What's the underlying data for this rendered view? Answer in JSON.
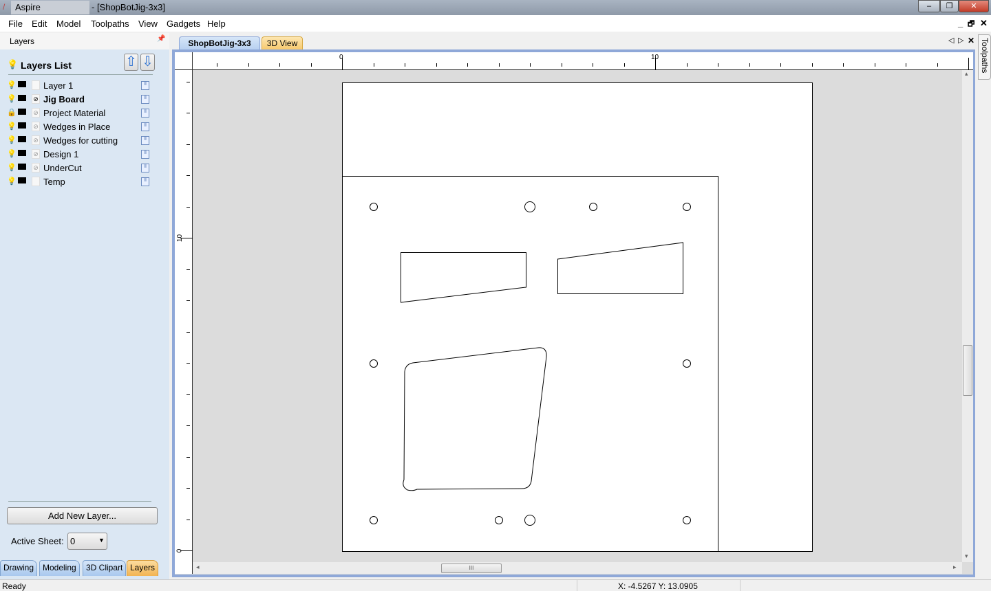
{
  "window": {
    "app_name": "Aspire",
    "document_title": "- [ShopBotJig-3x3]",
    "minimize": "–",
    "restore": "❐",
    "close": "✕"
  },
  "menu": [
    "File",
    "Edit",
    "Model",
    "Toolpaths",
    "View",
    "Gadgets",
    "Help"
  ],
  "mdi_controls": {
    "minimize": "_",
    "restore": "🗗",
    "close": "✕"
  },
  "layers_panel": {
    "title": "Layers",
    "pin": "📌",
    "list_title": "Layers List",
    "move_up": "⇧",
    "move_down": "⇩",
    "layers": [
      {
        "name": "Layer 1",
        "visible": false,
        "bold": false,
        "has_vectors": false
      },
      {
        "name": "Jig Board",
        "visible": true,
        "bold": true,
        "has_vectors": true
      },
      {
        "name": "Project Material",
        "visible": false,
        "locked": true,
        "bold": false,
        "has_vectors": true
      },
      {
        "name": "Wedges in Place",
        "visible": false,
        "bold": false,
        "has_vectors": true
      },
      {
        "name": "Wedges for cutting",
        "visible": true,
        "bold": false,
        "has_vectors": true
      },
      {
        "name": "Design 1",
        "visible": false,
        "bold": false,
        "has_vectors": true
      },
      {
        "name": "UnderCut",
        "visible": false,
        "bold": false,
        "has_vectors": true
      },
      {
        "name": "Temp",
        "visible": true,
        "bold": false,
        "has_vectors": false
      }
    ],
    "add_layer": "Add New Layer...",
    "active_sheet_label": "Active Sheet:",
    "active_sheet_value": "0"
  },
  "bottom_tabs": [
    "Drawing",
    "Modeling",
    "3D Clipart",
    "Layers"
  ],
  "active_bottom_tab": "Layers",
  "doc_tabs": [
    "ShopBotJig-3x3",
    "3D View"
  ],
  "tab_nav": {
    "prev": "◁",
    "next": "▷",
    "close": "✕"
  },
  "right_tab": "Toolpaths",
  "rulers": {
    "h_labels": [
      "0",
      "10"
    ],
    "v_labels": [
      "10",
      "0"
    ]
  },
  "scroll": {
    "grip": "III",
    "left": "◂",
    "right": "▸",
    "up": "▴",
    "down": "▾"
  },
  "status": {
    "text": "Ready",
    "coords": "X: -4.5267 Y: 13.0905"
  },
  "colors": {
    "panel_bg": "#dbe7f3",
    "active_tab": "#f7c86a",
    "canvas_bg": "#dcdcdc"
  }
}
